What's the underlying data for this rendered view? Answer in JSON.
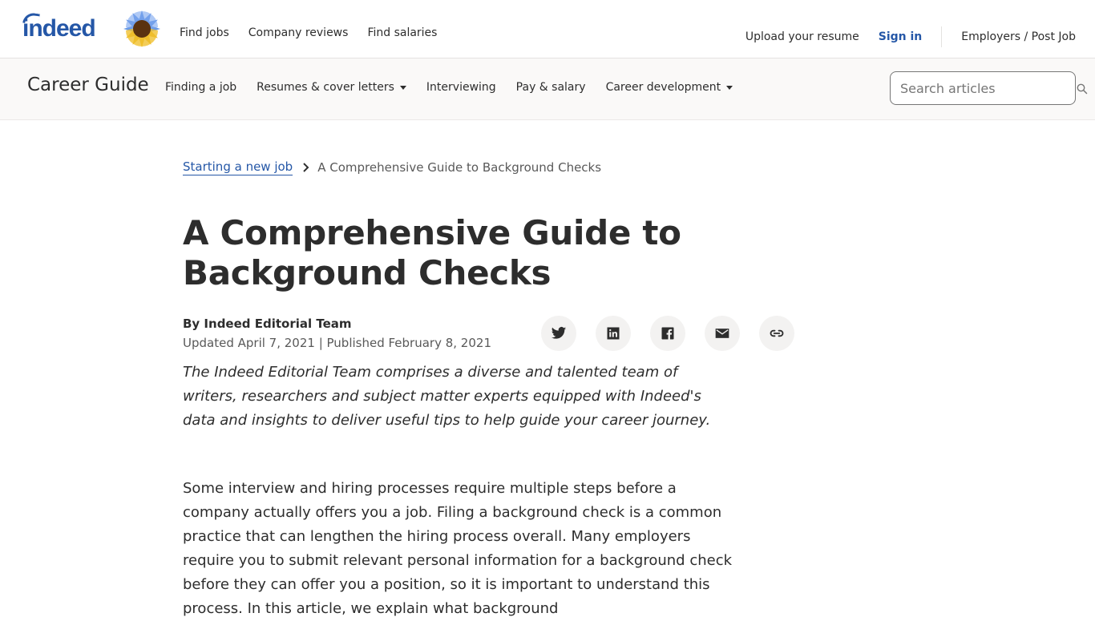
{
  "top_header": {
    "logo_text": "indeed",
    "nav": [
      "Find jobs",
      "Company reviews",
      "Find salaries"
    ],
    "upload_resume": "Upload your resume",
    "sign_in": "Sign in",
    "employers": "Employers / Post Job"
  },
  "sub_header": {
    "title": "Career Guide",
    "nav": [
      {
        "label": "Finding a job",
        "dropdown": false
      },
      {
        "label": "Resumes & cover letters",
        "dropdown": true
      },
      {
        "label": "Interviewing",
        "dropdown": false
      },
      {
        "label": "Pay & salary",
        "dropdown": false
      },
      {
        "label": "Career development",
        "dropdown": true
      }
    ],
    "search_placeholder": "Search articles",
    "search_value": ""
  },
  "breadcrumb": {
    "parent": "Starting a new job",
    "current": "A Comprehensive Guide to Background Checks"
  },
  "article": {
    "title": "A Comprehensive Guide to Background Checks",
    "author": "By Indeed Editorial Team",
    "dates": "Updated April 7, 2021 | Published February 8, 2021",
    "bio": "The Indeed Editorial Team comprises a diverse and talented team of writers, researchers and subject matter experts equipped with Indeed's data and insights to deliver useful tips to help guide your career journey.",
    "intro": "Some interview and hiring processes require multiple steps before a company actually offers you a job. Filing a background check is a common practice that can lengthen the hiring process overall. Many employers require you to submit relevant personal information for a background check before they can offer you a position, so it is important to understand this process. In this article, we explain what background"
  },
  "share": [
    {
      "name": "twitter-icon",
      "label": "Share on Twitter"
    },
    {
      "name": "linkedin-icon",
      "label": "Share on LinkedIn"
    },
    {
      "name": "facebook-icon",
      "label": "Share on Facebook"
    },
    {
      "name": "email-icon",
      "label": "Share via email"
    },
    {
      "name": "link-icon",
      "label": "Copy link"
    }
  ],
  "colors": {
    "brand_blue": "#2557a7",
    "text": "#2d2d2d",
    "muted": "#595959",
    "subheader_bg": "#faf9f8",
    "share_bg": "#f3f2f1"
  }
}
